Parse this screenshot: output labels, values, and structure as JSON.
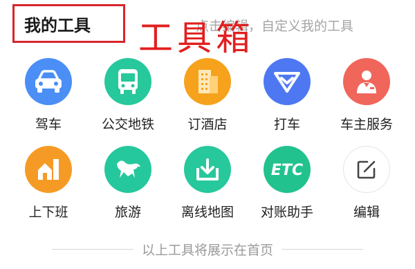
{
  "header": {
    "title": "我的工具",
    "hint": "点击编辑，自定义我的工具",
    "overlay_label": "工具箱"
  },
  "tools": [
    {
      "label": "驾车",
      "icon": "car-icon",
      "color": "#4b8ef5"
    },
    {
      "label": "公交地铁",
      "icon": "bus-icon",
      "color": "#27c89b"
    },
    {
      "label": "订酒店",
      "icon": "hotel-icon",
      "color": "#f6a21d"
    },
    {
      "label": "打车",
      "icon": "taxi-icon",
      "color": "#4e78f2"
    },
    {
      "label": "车主服务",
      "icon": "car-owner-icon",
      "color": "#f0665a"
    },
    {
      "label": "上下班",
      "icon": "commute-icon",
      "color": "#f59b25"
    },
    {
      "label": "旅游",
      "icon": "travel-horse-icon",
      "color": "#25c89c"
    },
    {
      "label": "离线地图",
      "icon": "offline-map-icon",
      "color": "#27c89b"
    },
    {
      "label": "对账助手",
      "icon": "etc-icon",
      "color": "#22c28e"
    },
    {
      "label": "编辑",
      "icon": "edit-icon",
      "color": "#ffffff"
    }
  ],
  "footer": {
    "text": "以上工具将展示在首页"
  }
}
